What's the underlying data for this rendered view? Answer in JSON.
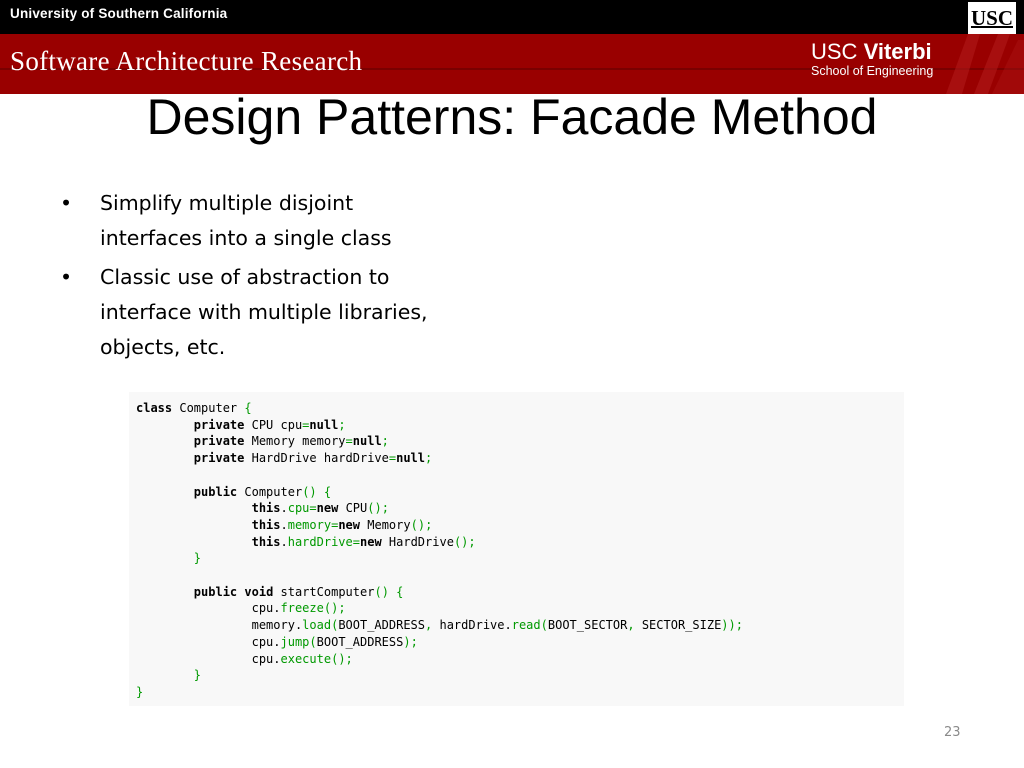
{
  "header": {
    "university": "University of Southern California",
    "usc_logo": "USC",
    "lab": "Software Architecture Research",
    "viterbi_line1": "USC Viterbi",
    "viterbi_line2": "School of Engineering"
  },
  "slide": {
    "title": "Design Patterns: Facade Method",
    "bullets": [
      "Simplify multiple disjoint interfaces into a single class",
      "Classic use of abstraction to interface with multiple libraries, objects, etc."
    ],
    "code_lines": [
      "class Computer {",
      "        private CPU cpu=null;",
      "        private Memory memory=null;",
      "        private HardDrive hardDrive=null;",
      "",
      "        public Computer() {",
      "                this.cpu=new CPU();",
      "                this.memory=new Memory();",
      "                this.hardDrive=new HardDrive();",
      "        }",
      "",
      "        public void startComputer() {",
      "                cpu.freeze();",
      "                memory.load(BOOT_ADDRESS, hardDrive.read(BOOT_SECTOR, SECTOR_SIZE));",
      "                cpu.jump(BOOT_ADDRESS);",
      "                cpu.execute();",
      "        }",
      "}"
    ],
    "page_number": "23"
  },
  "colors": {
    "usc_cardinal": "#990000",
    "header_black": "#000000",
    "code_bg": "#f8f8f8",
    "code_green": "#009900"
  }
}
